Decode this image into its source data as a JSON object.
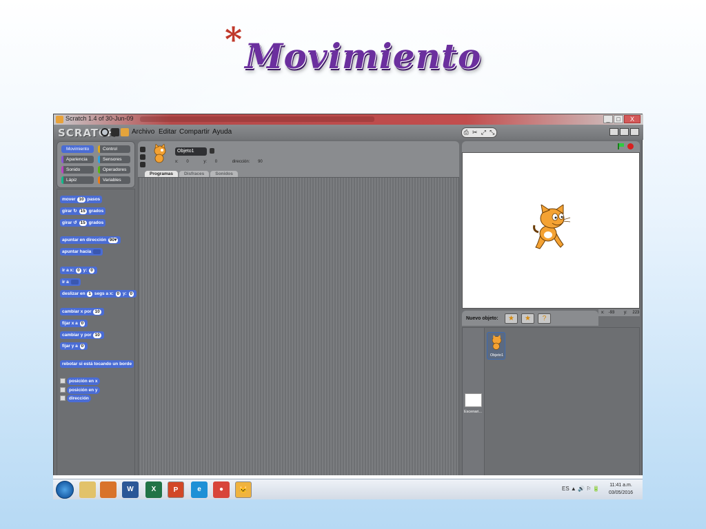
{
  "slide": {
    "bullet": "*",
    "title": "Movimiento"
  },
  "window": {
    "title": "Scratch 1.4 of 30-Jun-09",
    "controls": {
      "minimize": "_",
      "maximize": "□",
      "close": "X"
    }
  },
  "menubar": {
    "logo": "SCRATCH",
    "items": [
      "Archivo",
      "Editar",
      "Compartir",
      "Ayuda"
    ],
    "stage_tools": [
      "⎙",
      "✂",
      "⤢",
      "⤡"
    ]
  },
  "categories": [
    {
      "label": "Movimiento",
      "active": true
    },
    {
      "label": "Control",
      "active": false
    },
    {
      "label": "Apariencia",
      "active": false
    },
    {
      "label": "Sensores",
      "active": false
    },
    {
      "label": "Sonido",
      "active": false
    },
    {
      "label": "Operadores",
      "active": false
    },
    {
      "label": "Lápiz",
      "active": false
    },
    {
      "label": "Variables",
      "active": false
    }
  ],
  "category_colors": [
    "#4a6cd4",
    "#e1a91a",
    "#8a55d7",
    "#2ca5e2",
    "#bb42c3",
    "#5cb712",
    "#0fbd8c",
    "#ee7d16"
  ],
  "blocks": {
    "mover": {
      "a": "mover",
      "v": "10",
      "b": "pasos"
    },
    "girar_der": {
      "a": "girar ↻",
      "v": "15",
      "b": "grados"
    },
    "girar_izq": {
      "a": "girar ↺",
      "v": "15",
      "b": "grados"
    },
    "apuntar_dir": {
      "a": "apuntar en dirección",
      "v": "90▾"
    },
    "apuntar_hacia": {
      "a": "apuntar hacia"
    },
    "ir_xy": {
      "a": "ir a x:",
      "v1": "0",
      "b": "y:",
      "v2": "0"
    },
    "ir_a": {
      "a": "ir a"
    },
    "deslizar": {
      "a": "deslizar en",
      "v1": "1",
      "b": "segs a x:",
      "v2": "0",
      "c": "y:",
      "v3": "0"
    },
    "cambiar_x": {
      "a": "cambiar x por",
      "v": "10"
    },
    "fijar_x": {
      "a": "fijar x a",
      "v": "0"
    },
    "cambiar_y": {
      "a": "cambiar y por",
      "v": "10"
    },
    "fijar_y": {
      "a": "fijar y a",
      "v": "0"
    },
    "rebotar": {
      "a": "rebotar si está tocando un borde"
    },
    "pos_x": {
      "a": "posición en x"
    },
    "pos_y": {
      "a": "posición en y"
    },
    "direccion": {
      "a": "dirección"
    }
  },
  "sprite_header": {
    "name": "Objeto1",
    "x_label": "x:",
    "x": "0",
    "y_label": "y:",
    "y": "0",
    "dir_label": "dirección:",
    "dir": "90"
  },
  "tabs": [
    "Programas",
    "Disfraces",
    "Sonidos"
  ],
  "stage_mouse": {
    "x_label": "x:",
    "x": "-93",
    "y_label": "y:",
    "y": "223"
  },
  "new_sprite": {
    "label": "Nuevo objeto:"
  },
  "sprite_list": {
    "sprite": "Objeto1",
    "stage": "Escenari..."
  },
  "taskbar": {
    "apps": [
      "W",
      "X",
      "P",
      "e",
      "●",
      "🐱"
    ],
    "tray": "ES ▲ 🔊 ⚐ 🔋",
    "time": "11:41 a.m.",
    "date": "03/05/2016"
  }
}
